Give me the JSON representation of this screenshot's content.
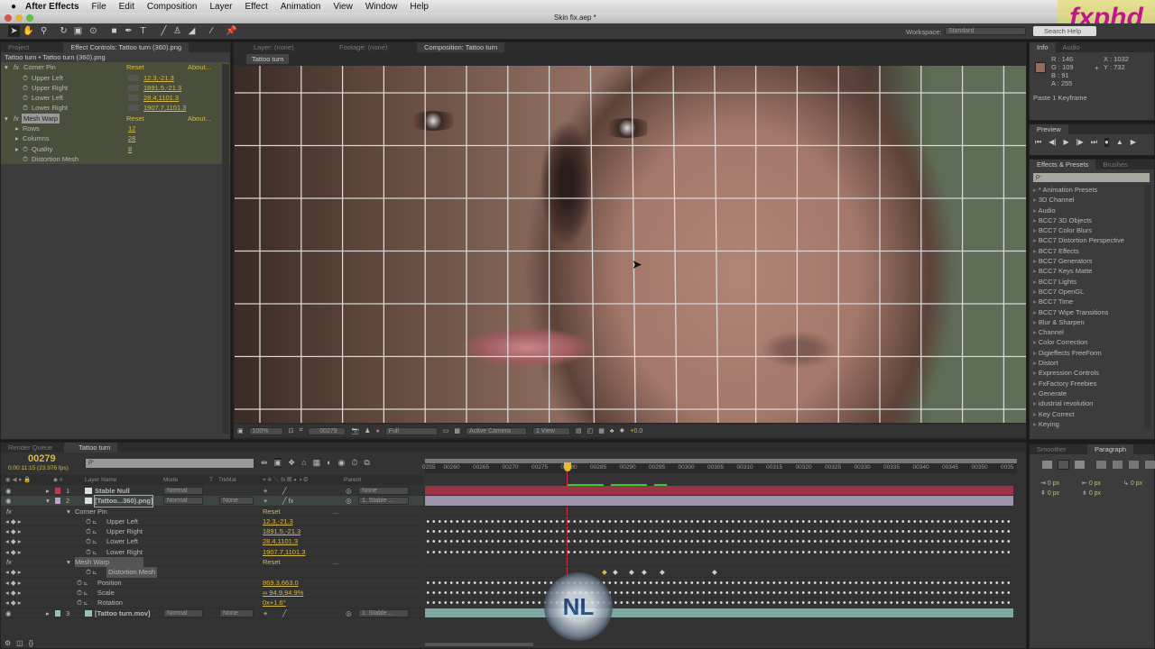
{
  "menubar": {
    "app": "After Effects",
    "items": [
      "File",
      "Edit",
      "Composition",
      "Layer",
      "Effect",
      "Animation",
      "View",
      "Window",
      "Help"
    ]
  },
  "window": {
    "title": "Skin fix.aep *"
  },
  "workspace": {
    "label": "Workspace:",
    "value": "Standard",
    "search_placeholder": "Search Help"
  },
  "watermark": "fxphd",
  "left_panel": {
    "tabs": [
      "Project",
      "Effect Controls: Tattoo turn (360).png"
    ],
    "breadcrumb": "Tattoo turn • Tattoo turn (360).png",
    "corner_pin": {
      "name": "Corner Pin",
      "reset": "Reset",
      "about": "About...",
      "props": [
        {
          "name": "Upper Left",
          "value": "12.3,-21.3"
        },
        {
          "name": "Upper Right",
          "value": "1891.5,-21.3"
        },
        {
          "name": "Lower Left",
          "value": "28.4,1101.3"
        },
        {
          "name": "Lower Right",
          "value": "1907.7,1101.3"
        }
      ]
    },
    "mesh_warp": {
      "name": "Mesh Warp",
      "reset": "Reset",
      "about": "About...",
      "props": [
        {
          "name": "Rows",
          "value": "12"
        },
        {
          "name": "Columns",
          "value": "28"
        },
        {
          "name": "Quality",
          "value": "8"
        },
        {
          "name": "Distortion Mesh",
          "value": ""
        }
      ]
    }
  },
  "viewer": {
    "tabs": [
      "Layer: (none)",
      "Footage: (none)",
      "Composition: Tattoo turn"
    ],
    "subtab": "Tattoo turn",
    "toolbar": {
      "zoom": "100%",
      "timecode": "00279",
      "resolution": "Full",
      "camera": "Active Camera",
      "views": "1 View",
      "exposure": "+0.0"
    }
  },
  "info": {
    "tabs": [
      "Info",
      "Audio"
    ],
    "r": "R : 146",
    "g": "G : 109",
    "b": "B : 91",
    "a": "A : 255",
    "x": "X : 1032",
    "y": "Y : 732",
    "swatch": "#92 6d5b",
    "message": "Paste 1 Keyframe",
    "swatch_color": "#926d5b"
  },
  "preview": {
    "tab": "Preview"
  },
  "effects": {
    "tabs": [
      "Effects & Presets",
      "Brushes"
    ],
    "search_placeholder": "ρ-",
    "items": [
      "* Animation Presets",
      "3D Channel",
      "Audio",
      "BCC7 3D Objects",
      "BCC7 Color Blurs",
      "BCC7 Distortion Perspective",
      "BCC7 Effects",
      "BCC7 Generators",
      "BCC7 Keys Matte",
      "BCC7 Lights",
      "BCC7 OpenGL",
      "BCC7 Time",
      "BCC7 Wipe Transitions",
      "Blur & Sharpen",
      "Channel",
      "Color Correction",
      "Digieffects FreeForm",
      "Distort",
      "Expression Controls",
      "FxFactory Freebies",
      "Generate",
      "idustrial revolution",
      "Key Correct",
      "Keying"
    ]
  },
  "paragraph": {
    "tabs": [
      "Smoother",
      "Paragraph"
    ],
    "fields": [
      "0 px",
      "0 px",
      "0 px",
      "0 px",
      "0 px"
    ]
  },
  "timeline": {
    "tabs": [
      "Render Queue",
      "Tattoo turn"
    ],
    "timecode": "00279",
    "subtime": "0:00:11:15 (23.976 fps)",
    "columns": {
      "name": "Layer Name",
      "mode": "Mode",
      "t": "T",
      "trkmat": "TrkMat",
      "parent": "Parent"
    },
    "ruler": [
      "0255",
      "00260",
      "00265",
      "00270",
      "00275",
      "00280",
      "00285",
      "00290",
      "00295",
      "00300",
      "00305",
      "00310",
      "00315",
      "00320",
      "00325",
      "00330",
      "00335",
      "00340",
      "00345",
      "00350",
      "0035"
    ],
    "current_frame": 279,
    "layers": [
      {
        "num": "1",
        "name": "Stable Null",
        "mode": "Normal",
        "trkmat": "",
        "parent": "None",
        "color": "#c8344a"
      },
      {
        "num": "2",
        "name": "[Tattoo...360).png]",
        "mode": "Normal",
        "trkmat": "None",
        "parent": "1. Stable ...",
        "color": "#b9a6c9"
      },
      {
        "num": "3",
        "name": "[Tattoo turn.mov]",
        "mode": "Normal",
        "trkmat": "None",
        "parent": "1. Stable ...",
        "color": "#8fc4bd"
      }
    ],
    "props": [
      {
        "name": "Corner Pin",
        "value": "Reset",
        "group": true
      },
      {
        "name": "Upper Left",
        "value": "12.3,-21.3"
      },
      {
        "name": "Upper Right",
        "value": "1891.5,-21.3"
      },
      {
        "name": "Lower Left",
        "value": "28.4,1101.3"
      },
      {
        "name": "Lower Right",
        "value": "1907.7,1101.3"
      },
      {
        "name": "Mesh Warp",
        "value": "Reset",
        "group": true
      },
      {
        "name": "Distortion Mesh",
        "value": ""
      },
      {
        "name": "Position",
        "value": "869.3,663.0"
      },
      {
        "name": "Scale",
        "value": "∞ 94.9,94.9%"
      },
      {
        "name": "Rotation",
        "value": "0x+1.6°"
      }
    ]
  }
}
